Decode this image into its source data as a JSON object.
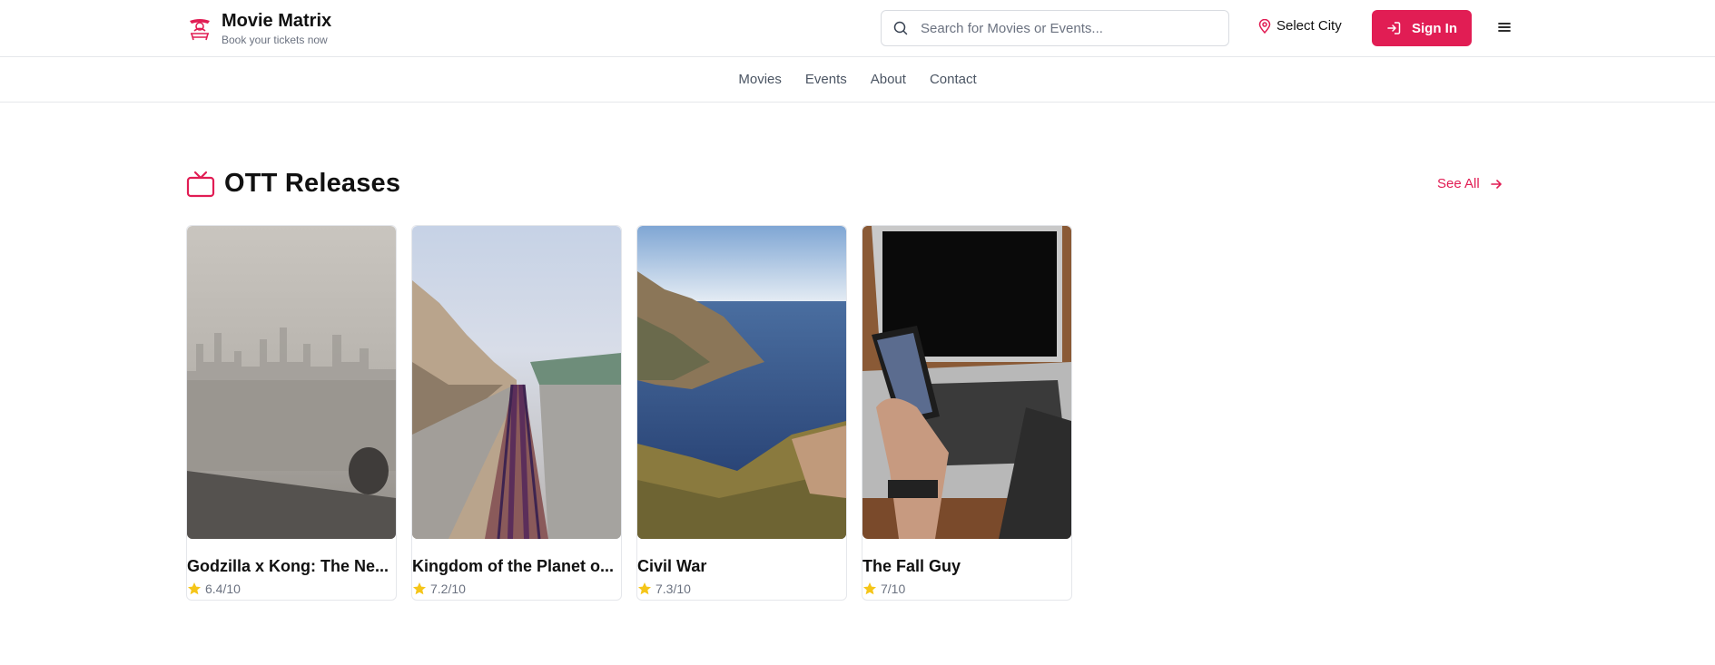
{
  "brand": {
    "name": "Movie Matrix",
    "tagline": "Book your tickets now",
    "logo_icon": "theater-masks-icon"
  },
  "search": {
    "placeholder": "Search for Movies or Events...",
    "value": ""
  },
  "city": {
    "label": "Select City",
    "icon": "map-pin-icon"
  },
  "signin": {
    "label": "Sign In",
    "icon": "log-in-icon"
  },
  "menu": {
    "icon": "hamburger-menu-icon"
  },
  "nav": {
    "items": [
      {
        "label": "Movies"
      },
      {
        "label": "Events"
      },
      {
        "label": "About"
      },
      {
        "label": "Contact"
      }
    ]
  },
  "section": {
    "title": "OTT Releases",
    "icon": "tv-icon",
    "see_all": "See All"
  },
  "movies": [
    {
      "title": "Godzilla x Kong: The New Empire",
      "title_display": "Godzilla x Kong: The Ne...",
      "rating": "6.4/10",
      "image": "foggy-city-skyline"
    },
    {
      "title": "Kingdom of the Planet of the Apes",
      "title_display": "Kingdom of the Planet o...",
      "rating": "7.2/10",
      "image": "railway-by-coast"
    },
    {
      "title": "Civil War",
      "title_display": "Civil War",
      "rating": "7.3/10",
      "image": "sea-cliff"
    },
    {
      "title": "The Fall Guy",
      "title_display": "The Fall Guy",
      "rating": "7/10",
      "image": "phone-and-laptop"
    }
  ],
  "colors": {
    "accent": "#e11d54",
    "star": "#f5c518",
    "text_muted": "#6b7280",
    "border": "#e5e7eb"
  }
}
